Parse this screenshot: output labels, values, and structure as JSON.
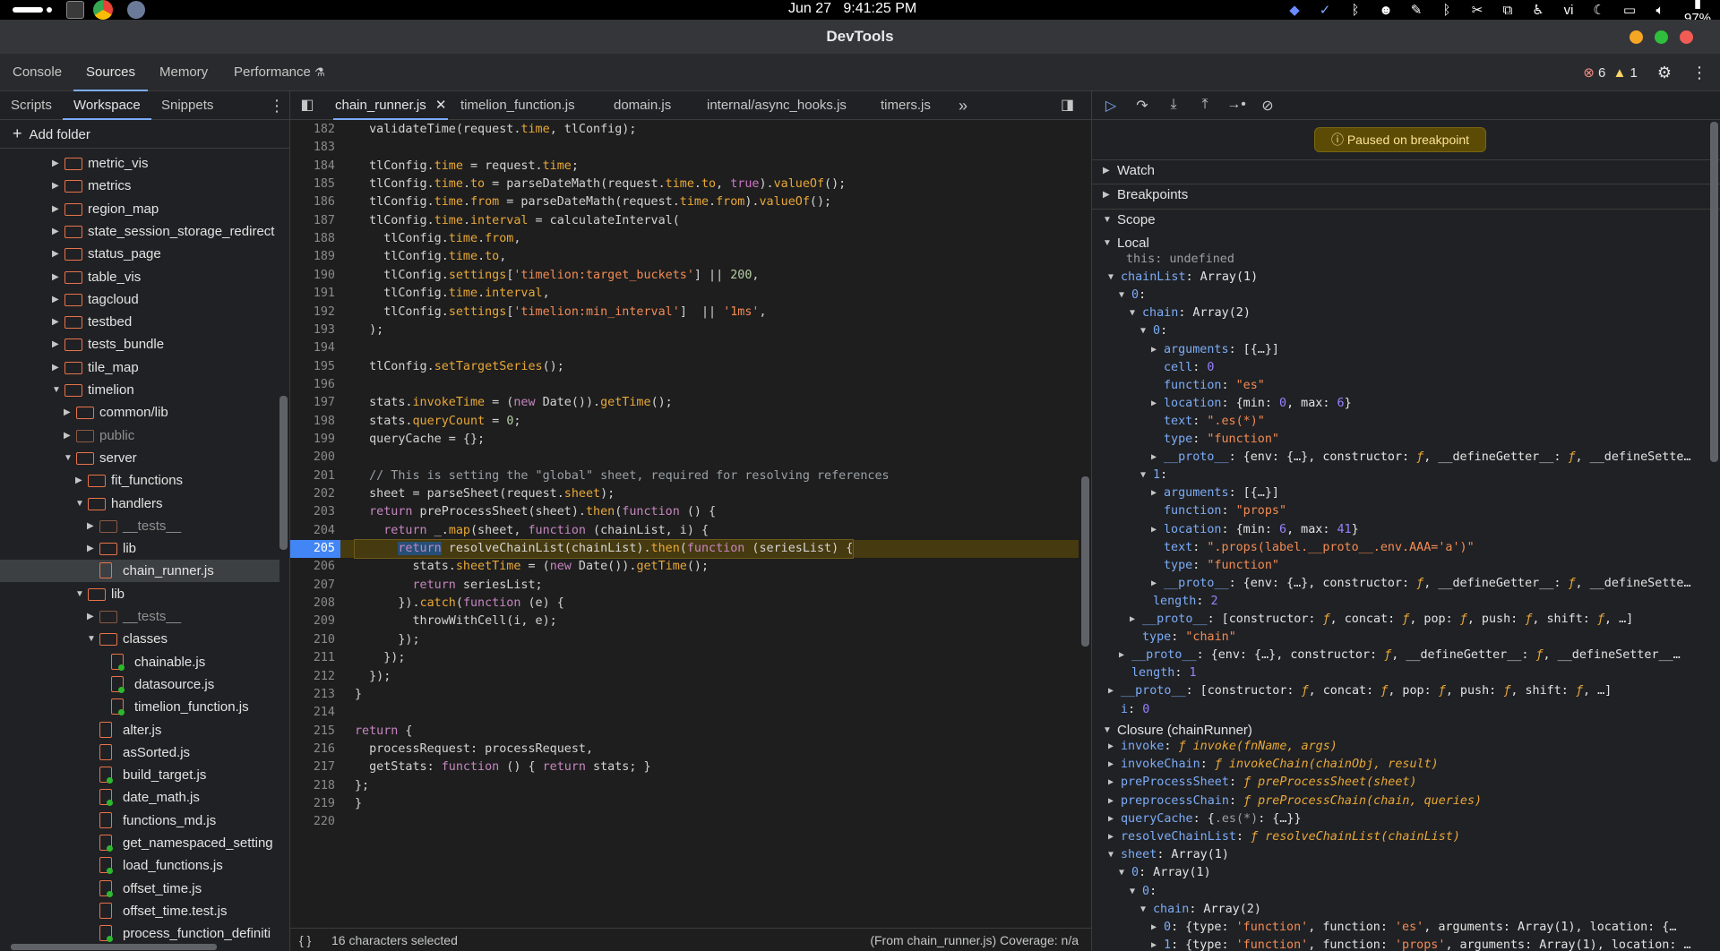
{
  "system": {
    "date": "Jun 27",
    "time": "9:41:25 PM",
    "ime": "vi",
    "battery": "97%"
  },
  "window": {
    "title": "DevTools"
  },
  "main_tabs": [
    "Console",
    "Sources",
    "Memory",
    "Performance"
  ],
  "issues": {
    "errors": "6",
    "warnings": "1"
  },
  "navigator": {
    "tabs": [
      "Scripts",
      "Workspace",
      "Snippets"
    ],
    "add_folder": "Add folder",
    "tree": [
      {
        "label": "metric_vis",
        "type": "folder",
        "depth": 0,
        "state": "collapsed"
      },
      {
        "label": "metrics",
        "type": "folder",
        "depth": 0,
        "state": "collapsed"
      },
      {
        "label": "region_map",
        "type": "folder",
        "depth": 0,
        "state": "collapsed"
      },
      {
        "label": "state_session_storage_redirect",
        "type": "folder",
        "depth": 0,
        "state": "collapsed"
      },
      {
        "label": "status_page",
        "type": "folder",
        "depth": 0,
        "state": "collapsed"
      },
      {
        "label": "table_vis",
        "type": "folder",
        "depth": 0,
        "state": "collapsed"
      },
      {
        "label": "tagcloud",
        "type": "folder",
        "depth": 0,
        "state": "collapsed"
      },
      {
        "label": "testbed",
        "type": "folder",
        "depth": 0,
        "state": "collapsed"
      },
      {
        "label": "tests_bundle",
        "type": "folder",
        "depth": 0,
        "state": "collapsed"
      },
      {
        "label": "tile_map",
        "type": "folder",
        "depth": 0,
        "state": "collapsed"
      },
      {
        "label": "timelion",
        "type": "folder",
        "depth": 0,
        "state": "expanded"
      },
      {
        "label": "common/lib",
        "type": "folder",
        "depth": 1,
        "state": "collapsed"
      },
      {
        "label": "public",
        "type": "folder",
        "depth": 1,
        "state": "collapsed",
        "dim": true
      },
      {
        "label": "server",
        "type": "folder",
        "depth": 1,
        "state": "expanded"
      },
      {
        "label": "fit_functions",
        "type": "folder",
        "depth": 2,
        "state": "collapsed"
      },
      {
        "label": "handlers",
        "type": "folder",
        "depth": 2,
        "state": "expanded"
      },
      {
        "label": "__tests__",
        "type": "folder",
        "depth": 3,
        "state": "collapsed",
        "dim": true
      },
      {
        "label": "lib",
        "type": "folder",
        "depth": 3,
        "state": "collapsed"
      },
      {
        "label": "chain_runner.js",
        "type": "file",
        "depth": 3,
        "selected": true
      },
      {
        "label": "lib",
        "type": "folder",
        "depth": 2,
        "state": "expanded"
      },
      {
        "label": "__tests__",
        "type": "folder",
        "depth": 3,
        "state": "collapsed",
        "dim": true
      },
      {
        "label": "classes",
        "type": "folder",
        "depth": 3,
        "state": "expanded"
      },
      {
        "label": "chainable.js",
        "type": "file",
        "depth": 4,
        "dot": true
      },
      {
        "label": "datasource.js",
        "type": "file",
        "depth": 4,
        "dot": true
      },
      {
        "label": "timelion_function.js",
        "type": "file",
        "depth": 4,
        "dot": true
      },
      {
        "label": "alter.js",
        "type": "file",
        "depth": 3
      },
      {
        "label": "asSorted.js",
        "type": "file",
        "depth": 3
      },
      {
        "label": "build_target.js",
        "type": "file",
        "depth": 3,
        "dot": true
      },
      {
        "label": "date_math.js",
        "type": "file",
        "depth": 3,
        "dot": true
      },
      {
        "label": "functions_md.js",
        "type": "file",
        "depth": 3
      },
      {
        "label": "get_namespaced_setting",
        "type": "file",
        "depth": 3,
        "dot": true
      },
      {
        "label": "load_functions.js",
        "type": "file",
        "depth": 3,
        "dot": true
      },
      {
        "label": "offset_time.js",
        "type": "file",
        "depth": 3,
        "dot": true
      },
      {
        "label": "offset_time.test.js",
        "type": "file",
        "depth": 3
      },
      {
        "label": "process_function_definiti",
        "type": "file",
        "depth": 3,
        "dot": true
      }
    ]
  },
  "editor": {
    "tabs": [
      {
        "label": "chain_runner.js",
        "active": true,
        "closable": true
      },
      {
        "label": "timelion_function.js"
      },
      {
        "label": "domain.js"
      },
      {
        "label": "internal/async_hooks.js"
      },
      {
        "label": "timers.js"
      }
    ],
    "breakpoint_line": "205",
    "lines": [
      {
        "n": "182",
        "code": "  validateTime(request.time, tlConfig);"
      },
      {
        "n": "183",
        "code": ""
      },
      {
        "n": "184",
        "code": "  tlConfig.time = request.time;"
      },
      {
        "n": "185",
        "code": "  tlConfig.time.to = parseDateMath(request.time.to, true).valueOf();"
      },
      {
        "n": "186",
        "code": "  tlConfig.time.from = parseDateMath(request.time.from).valueOf();"
      },
      {
        "n": "187",
        "code": "  tlConfig.time.interval = calculateInterval("
      },
      {
        "n": "188",
        "code": "    tlConfig.time.from,"
      },
      {
        "n": "189",
        "code": "    tlConfig.time.to,"
      },
      {
        "n": "190",
        "code": "    tlConfig.settings['timelion:target_buckets'] || 200,"
      },
      {
        "n": "191",
        "code": "    tlConfig.time.interval,"
      },
      {
        "n": "192",
        "code": "    tlConfig.settings['timelion:min_interval']  || '1ms',"
      },
      {
        "n": "193",
        "code": "  );"
      },
      {
        "n": "194",
        "code": ""
      },
      {
        "n": "195",
        "code": "  tlConfig.setTargetSeries();"
      },
      {
        "n": "196",
        "code": ""
      },
      {
        "n": "197",
        "code": "  stats.invokeTime = (new Date()).getTime();"
      },
      {
        "n": "198",
        "code": "  stats.queryCount = 0;"
      },
      {
        "n": "199",
        "code": "  queryCache = {};"
      },
      {
        "n": "200",
        "code": ""
      },
      {
        "n": "201",
        "code": "  // This is setting the \"global\" sheet, required for resolving references"
      },
      {
        "n": "202",
        "code": "  sheet = parseSheet(request.sheet);"
      },
      {
        "n": "203",
        "code": "  return preProcessSheet(sheet).then(function () {"
      },
      {
        "n": "204",
        "code": "    return _.map(sheet, function (chainList, i) {"
      },
      {
        "n": "205",
        "code": "      return resolveChainList(chainList).then(function (seriesList) {"
      },
      {
        "n": "206",
        "code": "        stats.sheetTime = (new Date()).getTime();"
      },
      {
        "n": "207",
        "code": "        return seriesList;"
      },
      {
        "n": "208",
        "code": "      }).catch(function (e) {"
      },
      {
        "n": "209",
        "code": "        throwWithCell(i, e);"
      },
      {
        "n": "210",
        "code": "      });"
      },
      {
        "n": "211",
        "code": "    });"
      },
      {
        "n": "212",
        "code": "  });"
      },
      {
        "n": "213",
        "code": "}"
      },
      {
        "n": "214",
        "code": ""
      },
      {
        "n": "215",
        "code": "return {"
      },
      {
        "n": "216",
        "code": "  processRequest: processRequest,"
      },
      {
        "n": "217",
        "code": "  getStats: function () { return stats; }"
      },
      {
        "n": "218",
        "code": "};"
      },
      {
        "n": "219",
        "code": "}"
      },
      {
        "n": "220",
        "code": ""
      }
    ],
    "status_left": "16 characters selected",
    "status_right": "(From chain_runner.js) Coverage: n/a",
    "format_icon": "{ }"
  },
  "debugger": {
    "paused_label": "Paused on breakpoint",
    "sections": [
      "Watch",
      "Breakpoints",
      "Scope"
    ],
    "scope_local": "Local",
    "scope_closure": "Closure (chainRunner)"
  },
  "colors": {
    "accent": "#7cacf8",
    "folder": "#e8734a",
    "breakpoint": "#4285f4",
    "paused_bg": "#5b4b05",
    "error": "#f28b82",
    "warning": "#fdd663"
  }
}
